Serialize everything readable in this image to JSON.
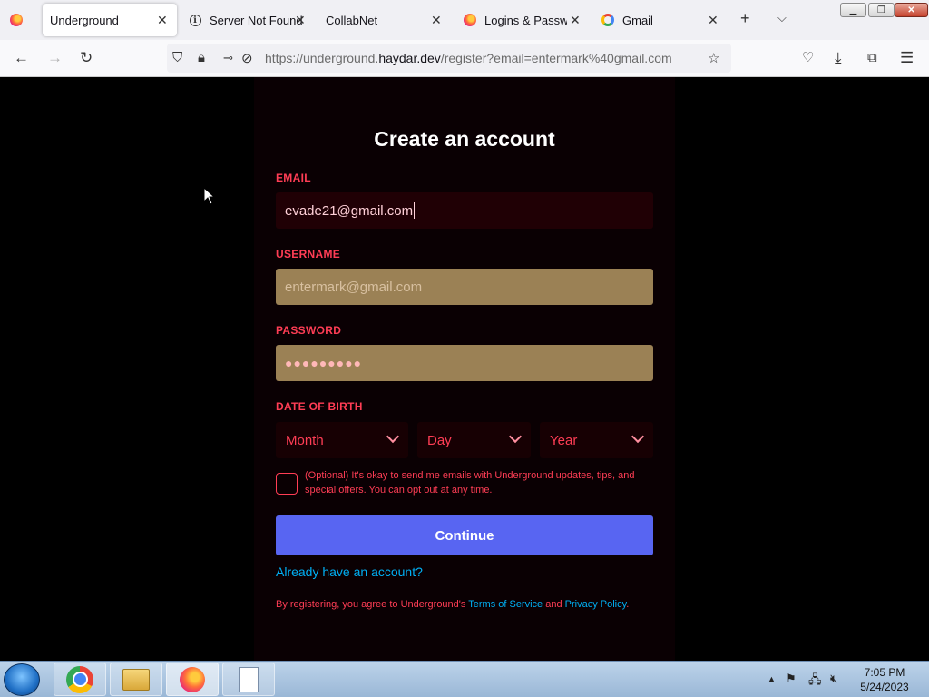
{
  "tabs": [
    {
      "label": "Underground",
      "icon": "firefox-icon",
      "active": true
    },
    {
      "label": "Server Not Found",
      "icon": "info-icon"
    },
    {
      "label": "CollabNet",
      "icon": ""
    },
    {
      "label": "Logins & Passwords",
      "icon": "firefox-icon"
    },
    {
      "label": "Gmail",
      "icon": "google-icon"
    }
  ],
  "nav": {
    "url_prefix": "https://underground.",
    "url_domain": "haydar.dev",
    "url_suffix": "/register?email=entermark%40gmail.com"
  },
  "form": {
    "title": "Create an account",
    "email_label": "EMAIL",
    "email_value": "evade21@gmail.com",
    "username_label": "USERNAME",
    "username_value": "entermark@gmail.com",
    "password_label": "PASSWORD",
    "password_value": "●●●●●●●●●",
    "dob_label": "DATE OF BIRTH",
    "month": "Month",
    "day": "Day",
    "year": "Year",
    "optin_text": "(Optional) It's okay to send me emails with Underground updates, tips, and special offers. You can opt out at any time.",
    "continue_label": "Continue",
    "already_label": "Already have an account?",
    "legal_prefix": "By registering, you agree to Underground's ",
    "terms_label": "Terms of Service",
    "legal_and": " and ",
    "privacy_label": "Privacy Policy",
    "legal_end": "."
  },
  "taskbar": {
    "time": "7:05 PM",
    "date": "5/24/2023"
  },
  "colors": {
    "accent": "#5865f2",
    "label_red": "#ff3d55",
    "link_blue": "#00aff4"
  }
}
